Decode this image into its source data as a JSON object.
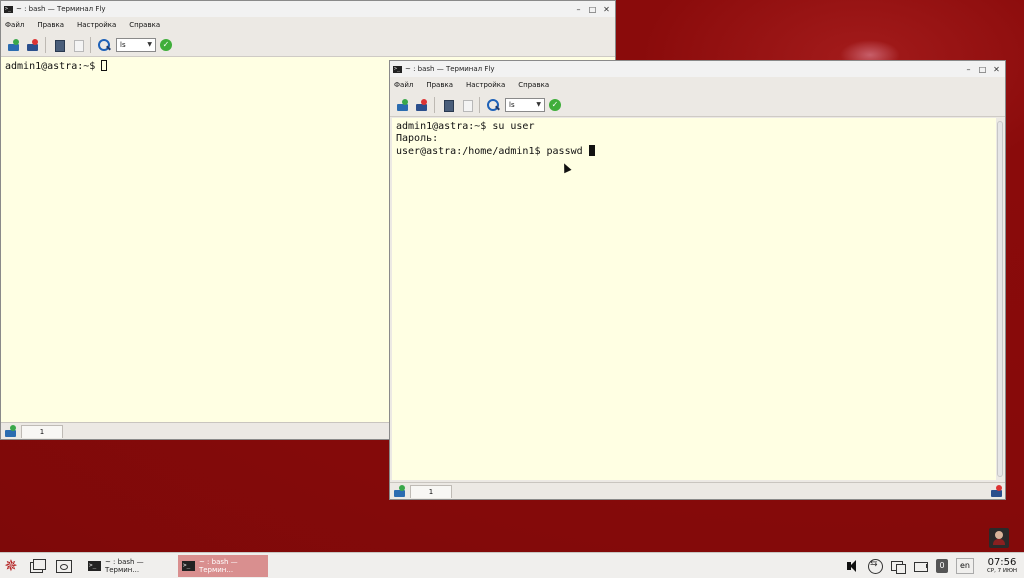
{
  "windows": {
    "back": {
      "title": "~ : bash — Терминал Fly",
      "menu": [
        "Файл",
        "Правка",
        "Настройка",
        "Справка"
      ],
      "combo_value": "ls",
      "terminal_lines": [
        "admin1@astra:~$ "
      ],
      "tab_label": "1"
    },
    "front": {
      "title": "~ : bash — Терминал Fly",
      "menu": [
        "Файл",
        "Правка",
        "Настройка",
        "Справка"
      ],
      "combo_value": "ls",
      "terminal_lines": [
        "admin1@astra:~$ su user",
        "Пароль:",
        "user@astra:/home/admin1$ passwd "
      ],
      "tab_label": "1"
    }
  },
  "taskbar": {
    "tasks": [
      {
        "label": "~ : bash — Термин...",
        "active": false
      },
      {
        "label": "~ : bash — Термин...",
        "active": true
      }
    ],
    "badge_count": "0",
    "language": "en",
    "time": "07:56",
    "date": "СР, 7 ИЮН"
  },
  "colors": {
    "desktop": "#8a0b0b",
    "terminal_bg": "#ffffe3",
    "active_task": "#d98f8f"
  }
}
